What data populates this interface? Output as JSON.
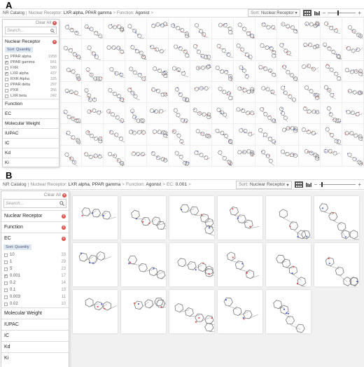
{
  "panels": {
    "a": {
      "letter": "A"
    },
    "b": {
      "letter": "B"
    }
  },
  "panel_a": {
    "breadcrumb": {
      "root": "NR Catalog",
      "filter1_key": "Nuclear Receptor:",
      "filter1_val": "LXR alpha, PPAR gamma",
      "filter2_key": "Function:",
      "filter2_val": "Agonist",
      "arrow": ">"
    },
    "sort": {
      "label": "Sort:",
      "value": "Nuclear Receptor",
      "caret": "▾"
    },
    "zoom": {
      "minus": "−",
      "plus": "+",
      "level": 0.35
    },
    "sidebar": {
      "clear_all": "Clear All",
      "search_placeholder": "Search...",
      "nuclear_receptor": "Nuclear Receptor",
      "sort_pill": "Sort: Quantity",
      "options": [
        {
          "name": "PPAR alpha",
          "count": "1958",
          "checked": false
        },
        {
          "name": "PPAR gamma",
          "count": "841",
          "checked": true
        },
        {
          "name": "FXR",
          "count": "580",
          "checked": false
        },
        {
          "name": "LXR alpha",
          "count": "437",
          "checked": true
        },
        {
          "name": "RXR Alpha",
          "count": "325",
          "checked": false
        },
        {
          "name": "PPAR delta",
          "count": "297",
          "checked": false
        },
        {
          "name": "PXR",
          "count": "266",
          "checked": false
        },
        {
          "name": "LXR beta",
          "count": "242",
          "checked": false
        }
      ],
      "sections": [
        "Function",
        "EC",
        "Molecular Weight",
        "IUPAC",
        "IC",
        "Kd",
        "Ki"
      ]
    }
  },
  "panel_b": {
    "breadcrumb": {
      "root": "NR Catalog",
      "filter1_key": "Nuclear Receptor:",
      "filter1_val": "LXR alpha, PPAR gamma",
      "filter2_key": "Function:",
      "filter2_val": "Agonist",
      "filter3_key": "EC:",
      "filter3_val": "0.001",
      "arrow": ">"
    },
    "sort": {
      "label": "Sort:",
      "value": "Nuclear Receptor",
      "caret": "▾"
    },
    "zoom": {
      "minus": "−",
      "plus": "+",
      "level": 0.05
    },
    "sidebar": {
      "clear_all": "Clear All",
      "search_placeholder": "Search...",
      "nuclear_receptor": "Nuclear Receptor",
      "function": "Function",
      "ec": "EC",
      "sort_pill": "Sort: Quantity",
      "options": [
        {
          "name": "10",
          "count": "33",
          "checked": false
        },
        {
          "name": "1",
          "count": "29",
          "checked": false
        },
        {
          "name": "5",
          "count": "23",
          "checked": false
        },
        {
          "name": "0.001",
          "count": "17",
          "checked": true
        },
        {
          "name": "0.2",
          "count": "14",
          "checked": false
        },
        {
          "name": "0.1",
          "count": "13",
          "checked": false
        },
        {
          "name": "0.003",
          "count": "11",
          "checked": false
        },
        {
          "name": "0.02",
          "count": "10",
          "checked": false
        }
      ],
      "sections": [
        "Molecular Weight",
        "IUPAC",
        "IC",
        "Kd",
        "Ki"
      ]
    },
    "structure_count": 17
  },
  "icons": {
    "grid_view": "grid-view-icon",
    "bar_view": "bar-view-icon",
    "clear": "clear-x-icon",
    "search": "magnifier-icon"
  },
  "colors": {
    "remove_dot": "#d9534f",
    "sort_pill_bg": "#dde8f3",
    "active_view": "#555555"
  }
}
